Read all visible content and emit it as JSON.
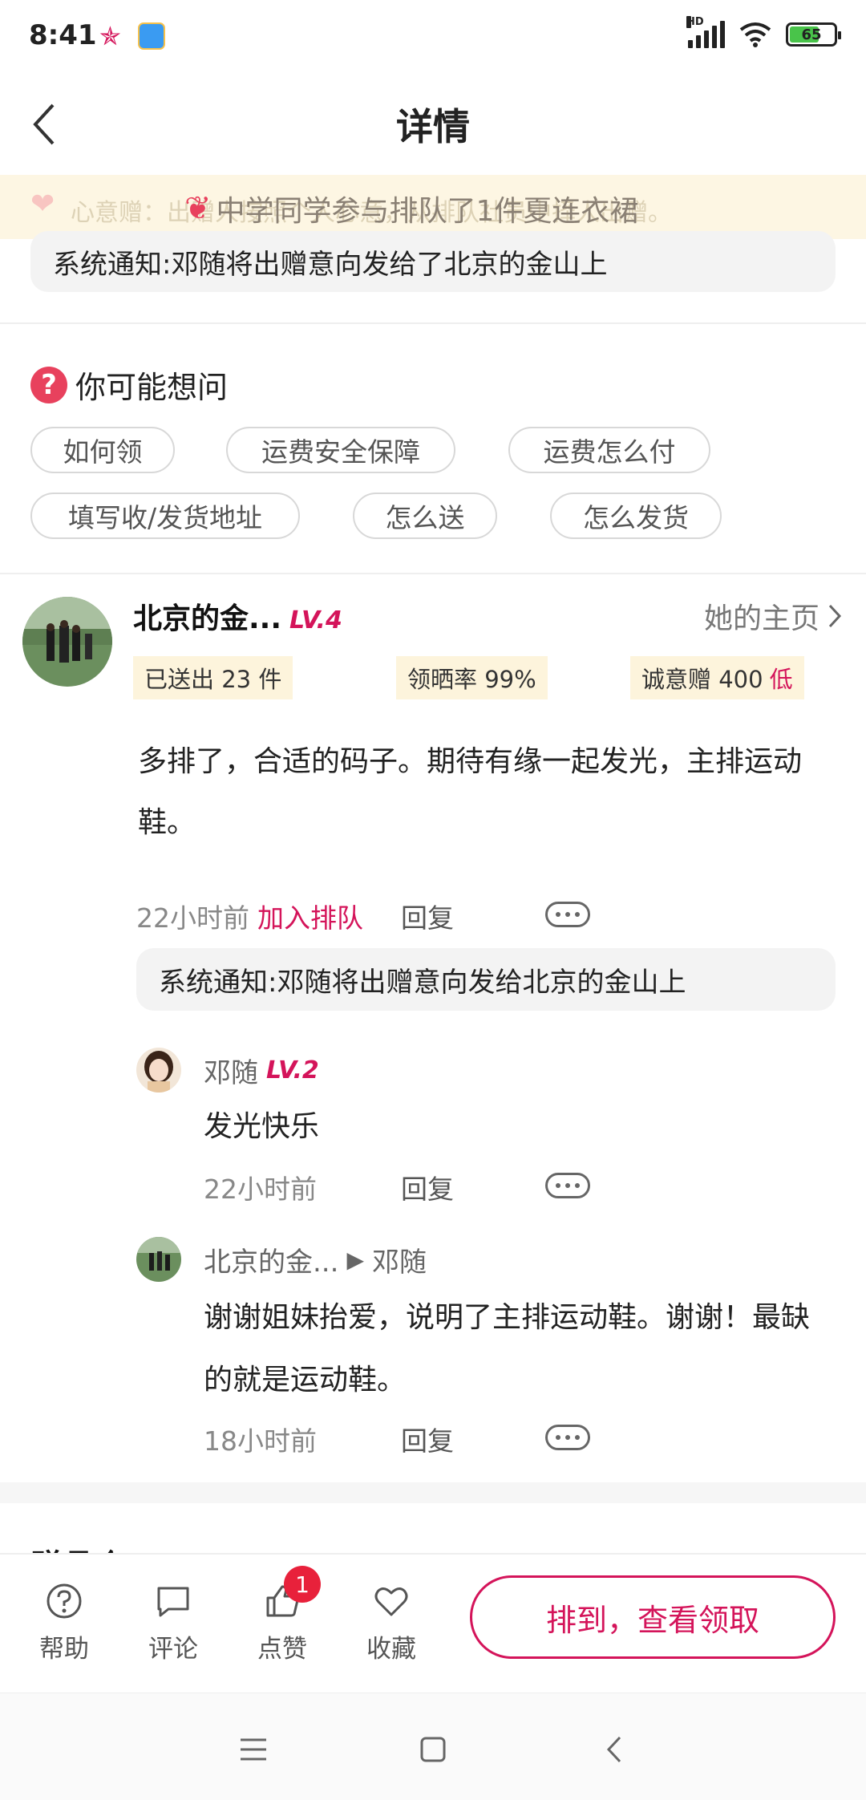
{
  "status": {
    "time": "8:41",
    "hd": "HD",
    "battery": "65"
  },
  "nav": {
    "title": "详情"
  },
  "banner": {
    "faded_text": "心意赠：出赠人按照个人心意，从排队社员中择人出赠。",
    "message": "中学同学参与排队了1件夏连衣裙"
  },
  "system_notice_1": "系统通知:邓随将出赠意向发给了北京的金山上",
  "faq": {
    "title": "你可能想问",
    "chips": [
      "如何领",
      "运费安全保障",
      "运费怎么付",
      "填写收/发货地址",
      "怎么送",
      "怎么发货"
    ]
  },
  "user": {
    "name": "北京的金...",
    "level": "LV.4",
    "homepage_label": "她的主页",
    "stats": {
      "sent": "已送出 23 件",
      "review_rate": "领晒率 99%",
      "sincerity": "诚意赠 400",
      "sincerity_level": "低"
    }
  },
  "post": {
    "text": "多排了，合适的码子。期待有缘一起发光，主排运动鞋。",
    "time": "22小时前",
    "join_label": "加入排队",
    "reply_label": "回复"
  },
  "system_notice_2": "系统通知:邓随将出赠意向发给北京的金山上",
  "comments": [
    {
      "name": "邓随",
      "level": "LV.2",
      "text": "发光快乐",
      "time": "22小时前",
      "reply_label": "回复"
    },
    {
      "name": "北京的金...",
      "arrow": "▶",
      "to": "邓随",
      "text": "谢谢姐妹抬爱，说明了主排运动鞋。谢谢！最缺的就是运动鞋。",
      "time": "18小时前",
      "reply_label": "回复"
    }
  ],
  "partial_heading": "赠品介",
  "bottom_bar": {
    "items": [
      {
        "label": "帮助",
        "icon": "help-icon"
      },
      {
        "label": "评论",
        "icon": "comment-icon"
      },
      {
        "label": "点赞",
        "icon": "like-icon",
        "badge": "1"
      },
      {
        "label": "收藏",
        "icon": "heart-icon"
      }
    ],
    "cta": "排到，查看领取"
  },
  "colors": {
    "accent": "#d4145a",
    "banner_bg": "#fdf6e3",
    "tag_bg": "#fdf4dc",
    "badge": "#e8213b"
  }
}
